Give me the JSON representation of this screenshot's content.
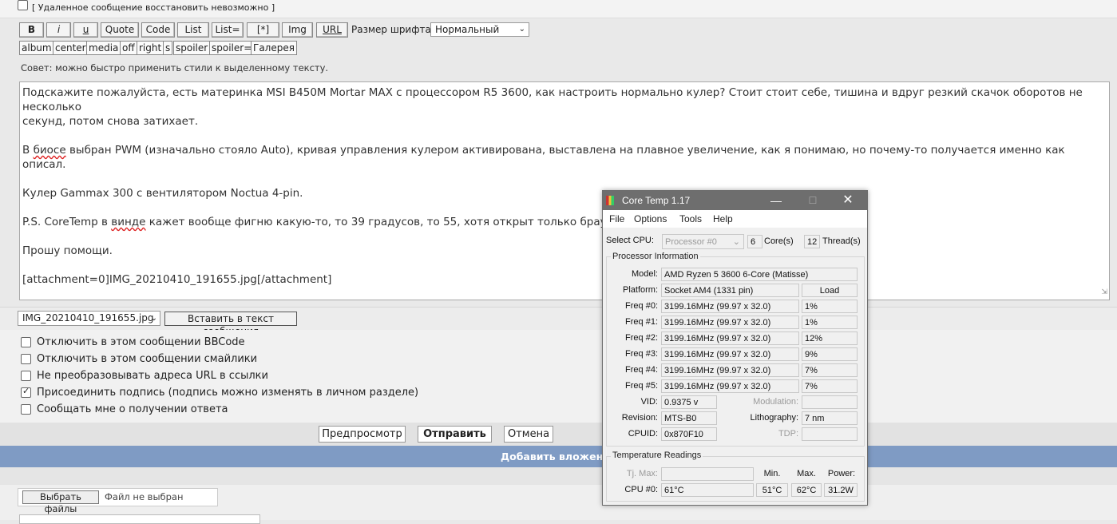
{
  "top": {
    "deleted_note": "[ Удаленное сообщение восстановить невозможно ]"
  },
  "toolbar": {
    "buttons": [
      "B",
      "i",
      "u",
      "Quote",
      "Code",
      "List",
      "List=",
      "[*]",
      "Img",
      "URL"
    ],
    "font_size_label": "Размер шрифта:",
    "font_size_value": "Нормальный",
    "tags": [
      "album",
      "center",
      "media",
      "off",
      "right",
      "s",
      "spoiler",
      "spoiler=",
      "Галерея"
    ],
    "tip": "Совет: можно быстро применить стили к выделенному тексту."
  },
  "editor": {
    "line1": "Подскажите пожалуйста, есть материнка MSI B450M Mortar MAX с процессором R5 3600, как настроить нормально кулер? Стоит стоит себе, тишина и вдруг резкий скачок оборотов не несколько",
    "line2": "секунд, потом снова затихает.",
    "p2_a": "В ",
    "p2_word": "биосе",
    "p2_b": " выбран PWM (изначально стояло Auto), кривая управления кулером активирована, выставлена на плавное увеличение, как я понимаю, но почему-то получается именно как описал.",
    "p3": "Кулер Gammax 300 с вентилятором Noctua 4-pin.",
    "p4_a": "P.S. CoreTemp в ",
    "p4_word": "винде",
    "p4_b": " кажет вообще фигню какую-то, то 39 градусов, то 55, хотя открыт только браузер",
    "p5": "Прошу помощи.",
    "p6": "[attachment=0]IMG_20210410_191655.jpg[/attachment]"
  },
  "attach": {
    "file": "IMG_20210410_191655.jpg",
    "insert_button": "Вставить в текст сообщения"
  },
  "options": [
    {
      "label": "Отключить в этом сообщении BBCode",
      "checked": false
    },
    {
      "label": "Отключить в этом сообщении смайлики",
      "checked": false
    },
    {
      "label": "Не преобразовывать адреса URL в ссылки",
      "checked": false
    },
    {
      "label": "Присоединить подпись (подпись можно изменять в личном разделе)",
      "checked": true
    },
    {
      "label": "Сообщать мне о получении ответа",
      "checked": false
    }
  ],
  "submit": {
    "preview": "Предпросмотр",
    "send": "Отправить",
    "cancel": "Отмена"
  },
  "attachments_bar": "Добавить вложения",
  "file_input": {
    "button": "Выбрать файлы",
    "status": "Файл не выбран"
  },
  "coretemp": {
    "title": "Core Temp 1.17",
    "menu": [
      "File",
      "Options",
      "Tools",
      "Help"
    ],
    "select_cpu_label": "Select CPU:",
    "select_cpu_value": "Processor #0",
    "cores": "6",
    "cores_label": "Core(s)",
    "threads": "12",
    "threads_label": "Thread(s)",
    "proc_info_title": "Processor Information",
    "model_label": "Model:",
    "model": "AMD Ryzen 5 3600 6-Core (Matisse)",
    "platform_label": "Platform:",
    "platform": "Socket AM4 (1331 pin)",
    "load_label": "Load",
    "freqs": [
      {
        "label": "Freq #0:",
        "value": "3199.16MHz (99.97 x 32.0)",
        "load": "1%"
      },
      {
        "label": "Freq #1:",
        "value": "3199.16MHz (99.97 x 32.0)",
        "load": "1%"
      },
      {
        "label": "Freq #2:",
        "value": "3199.16MHz (99.97 x 32.0)",
        "load": "12%"
      },
      {
        "label": "Freq #3:",
        "value": "3199.16MHz (99.97 x 32.0)",
        "load": "9%"
      },
      {
        "label": "Freq #4:",
        "value": "3199.16MHz (99.97 x 32.0)",
        "load": "7%"
      },
      {
        "label": "Freq #5:",
        "value": "3199.16MHz (99.97 x 32.0)",
        "load": "7%"
      }
    ],
    "vid_label": "VID:",
    "vid": "0.9375 v",
    "modulation_label": "Modulation:",
    "revision_label": "Revision:",
    "revision": "MTS-B0",
    "litho_label": "Lithography:",
    "litho": "7 nm",
    "cpuid_label": "CPUID:",
    "cpuid": "0x870F10",
    "tdp_label": "TDP:",
    "temp_title": "Temperature Readings",
    "tjmax_label": "Tj. Max:",
    "min_label": "Min.",
    "max_label": "Max.",
    "power_label": "Power:",
    "cpu0_label": "CPU #0:",
    "cpu0": "61°C",
    "cpu0_min": "51°C",
    "cpu0_max": "62°C",
    "cpu0_power": "31.2W"
  }
}
